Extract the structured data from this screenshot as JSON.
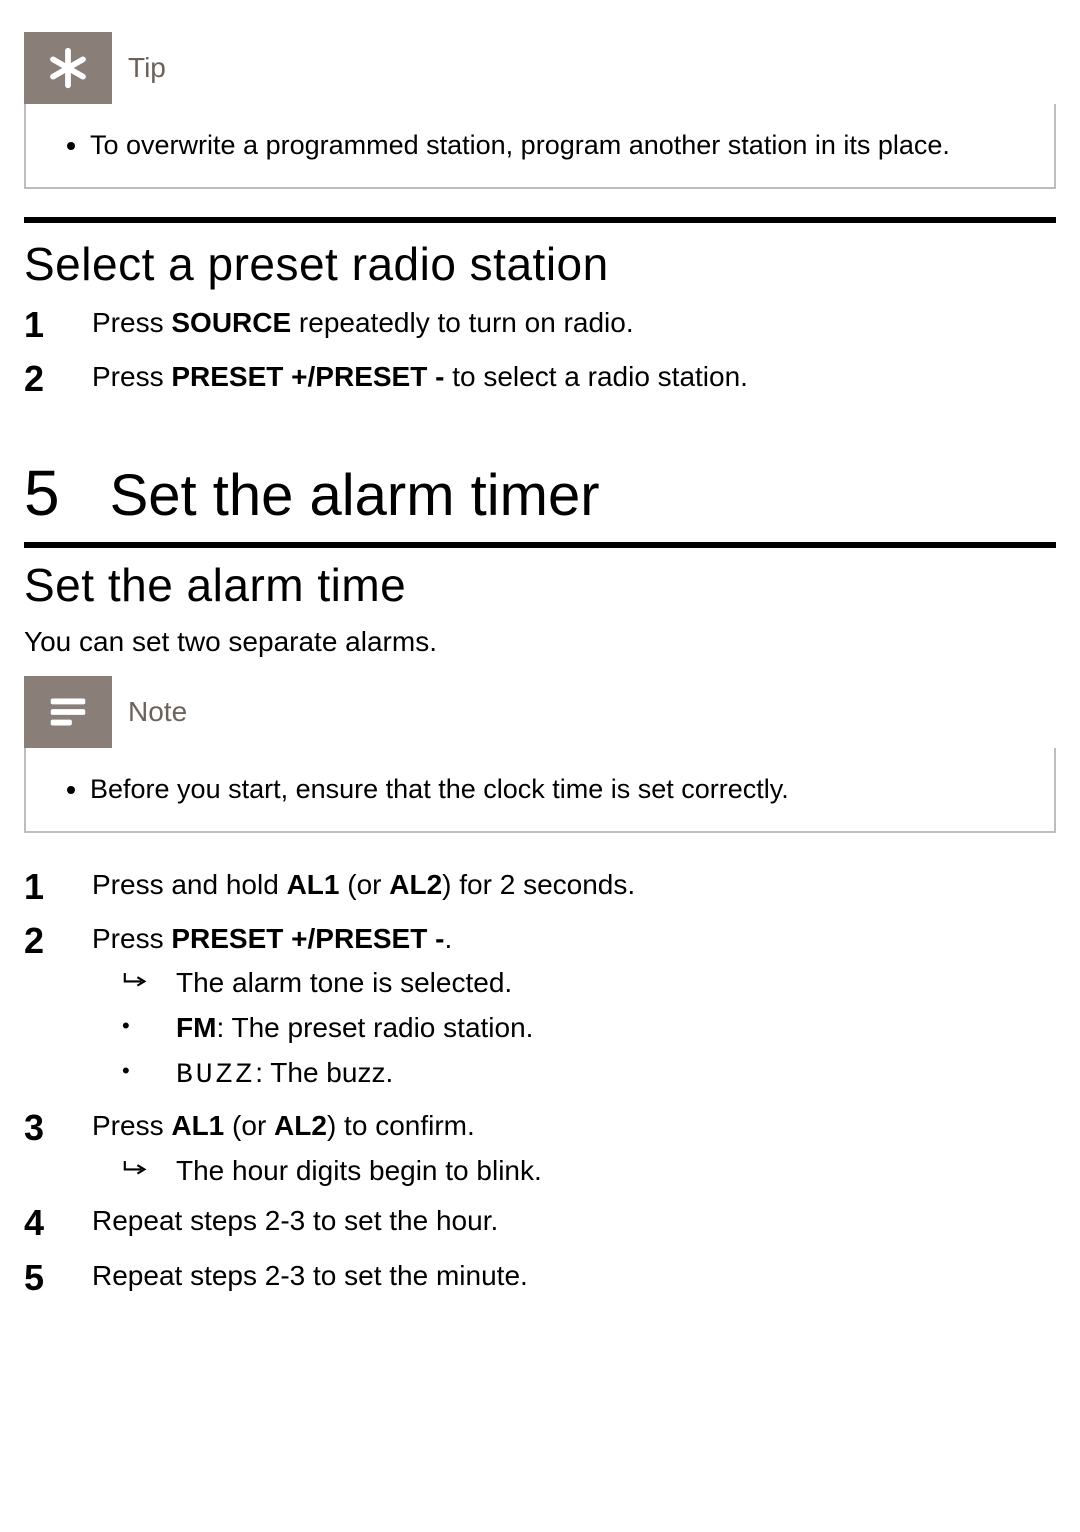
{
  "tip_box": {
    "label": "Tip",
    "items": [
      "To overwrite a programmed station, program another station in its place."
    ]
  },
  "section_preset": {
    "heading": "Select a preset radio station",
    "steps": [
      {
        "pre": "Press ",
        "kw": "SOURCE",
        "post": " repeatedly to turn on radio."
      },
      {
        "pre": "Press ",
        "kw": "PRESET +/PRESET -",
        "post": " to select a radio station."
      }
    ]
  },
  "chapter": {
    "num": "5",
    "title": "Set the alarm timer"
  },
  "section_alarm": {
    "heading": "Set the alarm time",
    "intro": "You can set two separate alarms."
  },
  "note_box": {
    "label": "Note",
    "items": [
      "Before you start, ensure that the clock time is set correctly."
    ]
  },
  "alarm_steps": {
    "s1": {
      "pre": "Press and hold ",
      "kw1": "AL1",
      "mid": " (or ",
      "kw2": "AL2",
      "post": ") for 2 seconds."
    },
    "s2": {
      "pre": "Press ",
      "kw": "PRESET +/PRESET -",
      "post": ".",
      "result": "The alarm tone is selected.",
      "opt1": {
        "kw": "FM",
        "post": ": The preset radio station."
      },
      "opt2": {
        "seg": "BUZZ",
        "post": ": The buzz."
      }
    },
    "s3": {
      "pre": "Press ",
      "kw1": "AL1",
      "mid": " (or ",
      "kw2": "AL2",
      "post": ") to confirm.",
      "result": "The hour digits begin to blink."
    },
    "s4": {
      "text": "Repeat steps 2-3 to set the hour."
    },
    "s5": {
      "text": "Repeat steps 2-3 to set the minute."
    }
  }
}
